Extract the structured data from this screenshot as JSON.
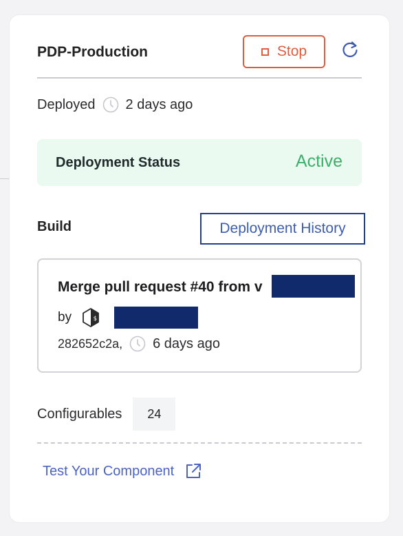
{
  "header": {
    "title": "PDP-Production",
    "stop_label": "Stop"
  },
  "deployment": {
    "label": "Deployed",
    "time": "2 days ago"
  },
  "status": {
    "label": "Deployment Status",
    "value": "Active"
  },
  "build": {
    "label": "Build",
    "history_label": "Deployment History",
    "commit_message": "Merge pull request #40 from v",
    "by_label": "by",
    "commit_hash": "282652c2a,",
    "commit_time": "6 days ago"
  },
  "configurables": {
    "label": "Configurables",
    "count": "24"
  },
  "test_link": {
    "label": "Test Your Component"
  },
  "icons": [
    "refresh-icon",
    "clock-icon",
    "bash-icon",
    "external-link-icon",
    "stop-icon"
  ],
  "colors": {
    "danger": "#e25b3b",
    "success": "#3fae6a",
    "success_bg": "#eafaf0",
    "link": "#4b63c1",
    "history_border": "#1f3f95",
    "redaction": "#102a6b"
  }
}
